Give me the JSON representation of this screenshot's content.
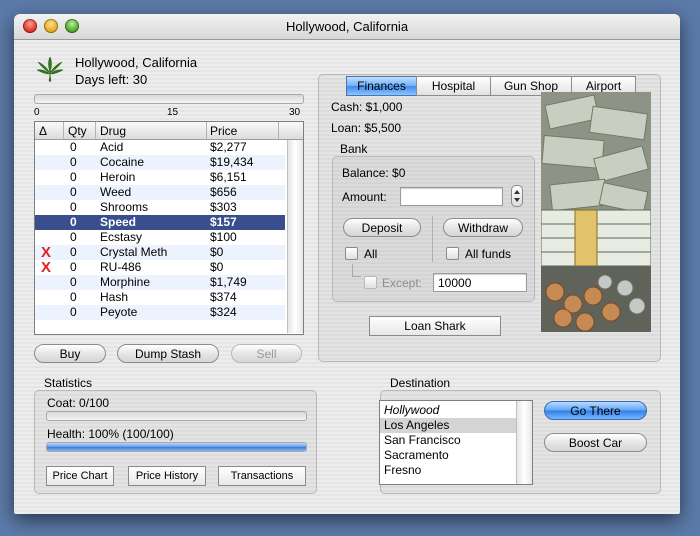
{
  "window": {
    "title": "Hollywood, California"
  },
  "header": {
    "location": "Hollywood, California",
    "days_left": "Days left: 30"
  },
  "slider": {
    "min": "0",
    "mid": "15",
    "max": "30",
    "value": 0
  },
  "drug_table": {
    "columns": [
      "Δ",
      "Qty",
      "Drug",
      "Price"
    ],
    "rows": [
      {
        "qty": "0",
        "drug": "Acid",
        "price": "$2,277"
      },
      {
        "qty": "0",
        "drug": "Cocaine",
        "price": "$19,434"
      },
      {
        "qty": "0",
        "drug": "Heroin",
        "price": "$6,151"
      },
      {
        "qty": "0",
        "drug": "Weed",
        "price": "$656"
      },
      {
        "qty": "0",
        "drug": "Shrooms",
        "price": "$303"
      },
      {
        "qty": "0",
        "drug": "Speed",
        "price": "$157"
      },
      {
        "qty": "0",
        "drug": "Ecstasy",
        "price": "$100"
      },
      {
        "qty": "0",
        "drug": "Crystal Meth",
        "price": "$0"
      },
      {
        "qty": "0",
        "drug": "RU-486",
        "price": "$0"
      },
      {
        "qty": "0",
        "drug": "Morphine",
        "price": "$1,749"
      },
      {
        "qty": "0",
        "drug": "Hash",
        "price": "$374"
      },
      {
        "qty": "0",
        "drug": "Peyote",
        "price": "$324"
      }
    ],
    "selected_index": 5,
    "unavailable_mark": "X"
  },
  "actions": {
    "buy": "Buy",
    "dump": "Dump Stash",
    "sell": "Sell"
  },
  "tabs": [
    "Finances",
    "Hospital",
    "Gun Shop",
    "Airport"
  ],
  "finances": {
    "cash": "Cash: $1,000",
    "loan": "Loan: $5,500",
    "bank_title": "Bank",
    "balance": "Balance: $0",
    "amount_label": "Amount:",
    "amount_value": "",
    "deposit": "Deposit",
    "withdraw": "Withdraw",
    "all": "All",
    "all_funds": "All funds",
    "except": "Except:",
    "except_value": "10000",
    "loan_shark": "Loan Shark"
  },
  "statistics": {
    "title": "Statistics",
    "coat": "Coat: 0/100",
    "coat_fill": 0,
    "health": "Health: 100% (100/100)",
    "health_fill": 1.0,
    "price_chart": "Price Chart",
    "price_history": "Price History",
    "transactions": "Transactions"
  },
  "destination": {
    "title": "Destination",
    "cities": [
      "Hollywood",
      "Los Angeles",
      "San Francisco",
      "Sacramento",
      "Fresno"
    ],
    "current_index": 0,
    "selected_index": 1,
    "go_there": "Go There",
    "boost_car": "Boost Car"
  },
  "icons": {
    "logo": "cannabis-leaf-icon",
    "photo": "money-pile-photo"
  },
  "colors": {
    "selection": "#3a4d8c",
    "alt_row": "#edf3fe",
    "x_mark": "#e0231d",
    "progress": "#3b7ad4"
  }
}
